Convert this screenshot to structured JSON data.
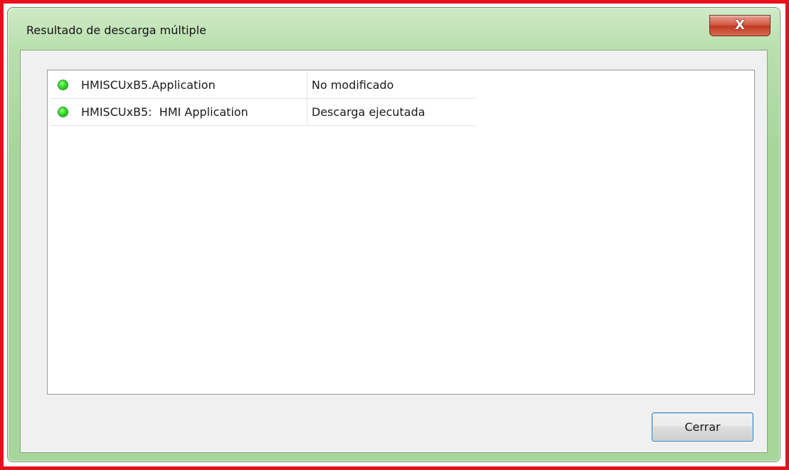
{
  "window": {
    "title": "Resultado de descarga múltiple",
    "close_glyph": "X"
  },
  "results": [
    {
      "icon": "green-status-icon",
      "name": "HMISCUxB5.Application",
      "status": "No modificado"
    },
    {
      "icon": "green-status-icon",
      "name": "HMISCUxB5:  HMI Application",
      "status": "Descarga ejecutada"
    }
  ],
  "buttons": {
    "close_label": "Cerrar"
  },
  "colors": {
    "frame_highlight": "#e8101c",
    "window_chrome": "#a6d69a",
    "status_ok": "#2ed82a",
    "close_button": "#c13a22"
  }
}
